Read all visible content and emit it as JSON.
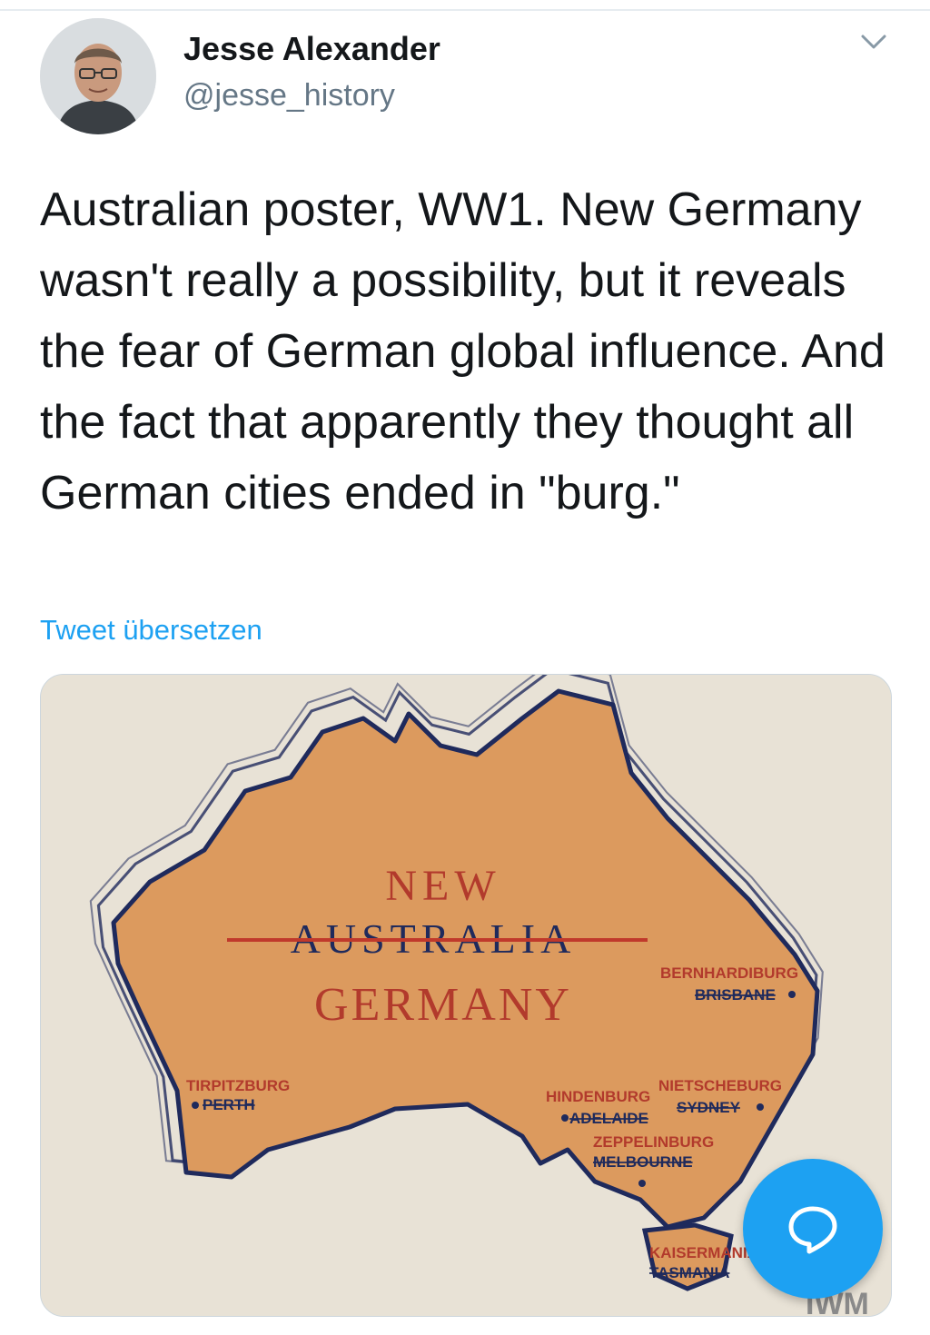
{
  "tweet": {
    "display_name": "Jesse Alexander",
    "handle": "@jesse_history",
    "text": "Australian poster, WW1. New Germany wasn't really a possibility, but it reveals the fear of German global influence. And the fact that apparently they thought all German cities ended in \"burg.\"",
    "translate_label": "Tweet übersetzen"
  },
  "poster": {
    "title_top": "NEW",
    "title_struck": "AUSTRALIA",
    "title_bottom": "GERMANY",
    "cities": [
      {
        "new_name": "BERNHARDIBURG",
        "old_name": "BRISBANE"
      },
      {
        "new_name": "TIRPITZBURG",
        "old_name": "PERTH"
      },
      {
        "new_name": "HINDENBURG",
        "old_name": "ADELAIDE"
      },
      {
        "new_name": "NIETSCHEBURG",
        "old_name": "SYDNEY"
      },
      {
        "new_name": "ZEPPELINBURG",
        "old_name": "MELBOURNE"
      },
      {
        "new_name": "KAISERMANIA",
        "old_name": "TASMANIA"
      }
    ],
    "watermark": "IWM"
  },
  "icons": {
    "caret": "chevron-down-icon",
    "compose": "reply-bubble-icon"
  },
  "colors": {
    "accent": "#1da1f2",
    "land": "#dc9a5e",
    "ocean_outline": "#1f2a5c",
    "title_red": "#b23a2c",
    "strike_red": "#c0392b"
  }
}
